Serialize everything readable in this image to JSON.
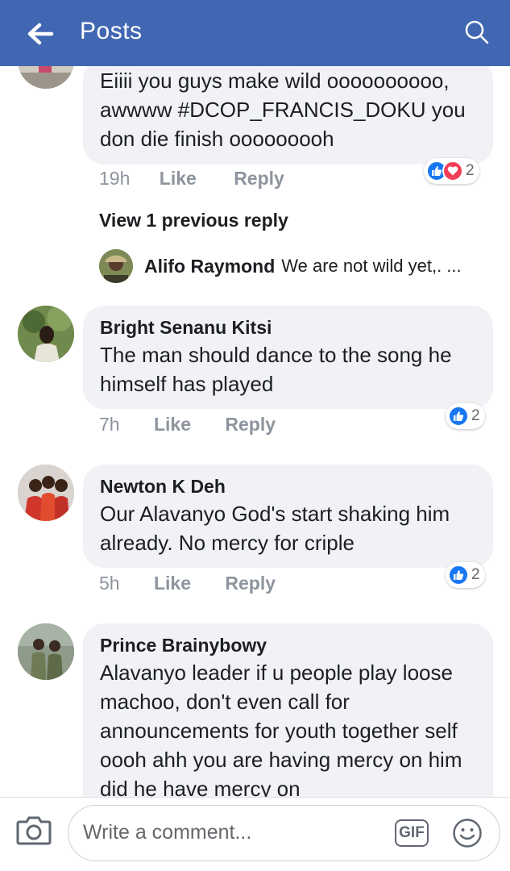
{
  "header": {
    "title": "Posts"
  },
  "comments": [
    {
      "name": "",
      "text": "Eiiii you guys make wild oooooooooo, awwww #DCOP_FRANCIS_DOKU you don die finish ooooooooh",
      "time": "19h",
      "like_label": "Like",
      "reply_label": "Reply",
      "reactions": [
        "like",
        "love"
      ],
      "reaction_count": "2",
      "view_previous": "View 1 previous reply",
      "reply": {
        "name": "Alifo Raymond",
        "text": "We are not wild yet,. ..."
      }
    },
    {
      "name": "Bright Senanu Kitsi",
      "text": "The man should dance to the song he himself has played",
      "time": "7h",
      "like_label": "Like",
      "reply_label": "Reply",
      "reactions": [
        "like"
      ],
      "reaction_count": "2"
    },
    {
      "name": "Newton K Deh",
      "text": "Our Alavanyo God's start shaking him already. No mercy for criple",
      "time": "5h",
      "like_label": "Like",
      "reply_label": "Reply",
      "reactions": [
        "like"
      ],
      "reaction_count": "2"
    },
    {
      "name": "Prince Brainybowy",
      "text": "Alavanyo leader if u people play loose machoo, don't even call for announcements for youth together self  oooh ahh you are having mercy on him did he have mercy on"
    }
  ],
  "composer": {
    "placeholder": "Write a comment...",
    "gif_label": "GIF"
  },
  "colors": {
    "header_bg": "#4267b2",
    "bubble_bg": "#f0f2f5",
    "like_blue": "#1877f2",
    "love_red": "#f33e58"
  }
}
